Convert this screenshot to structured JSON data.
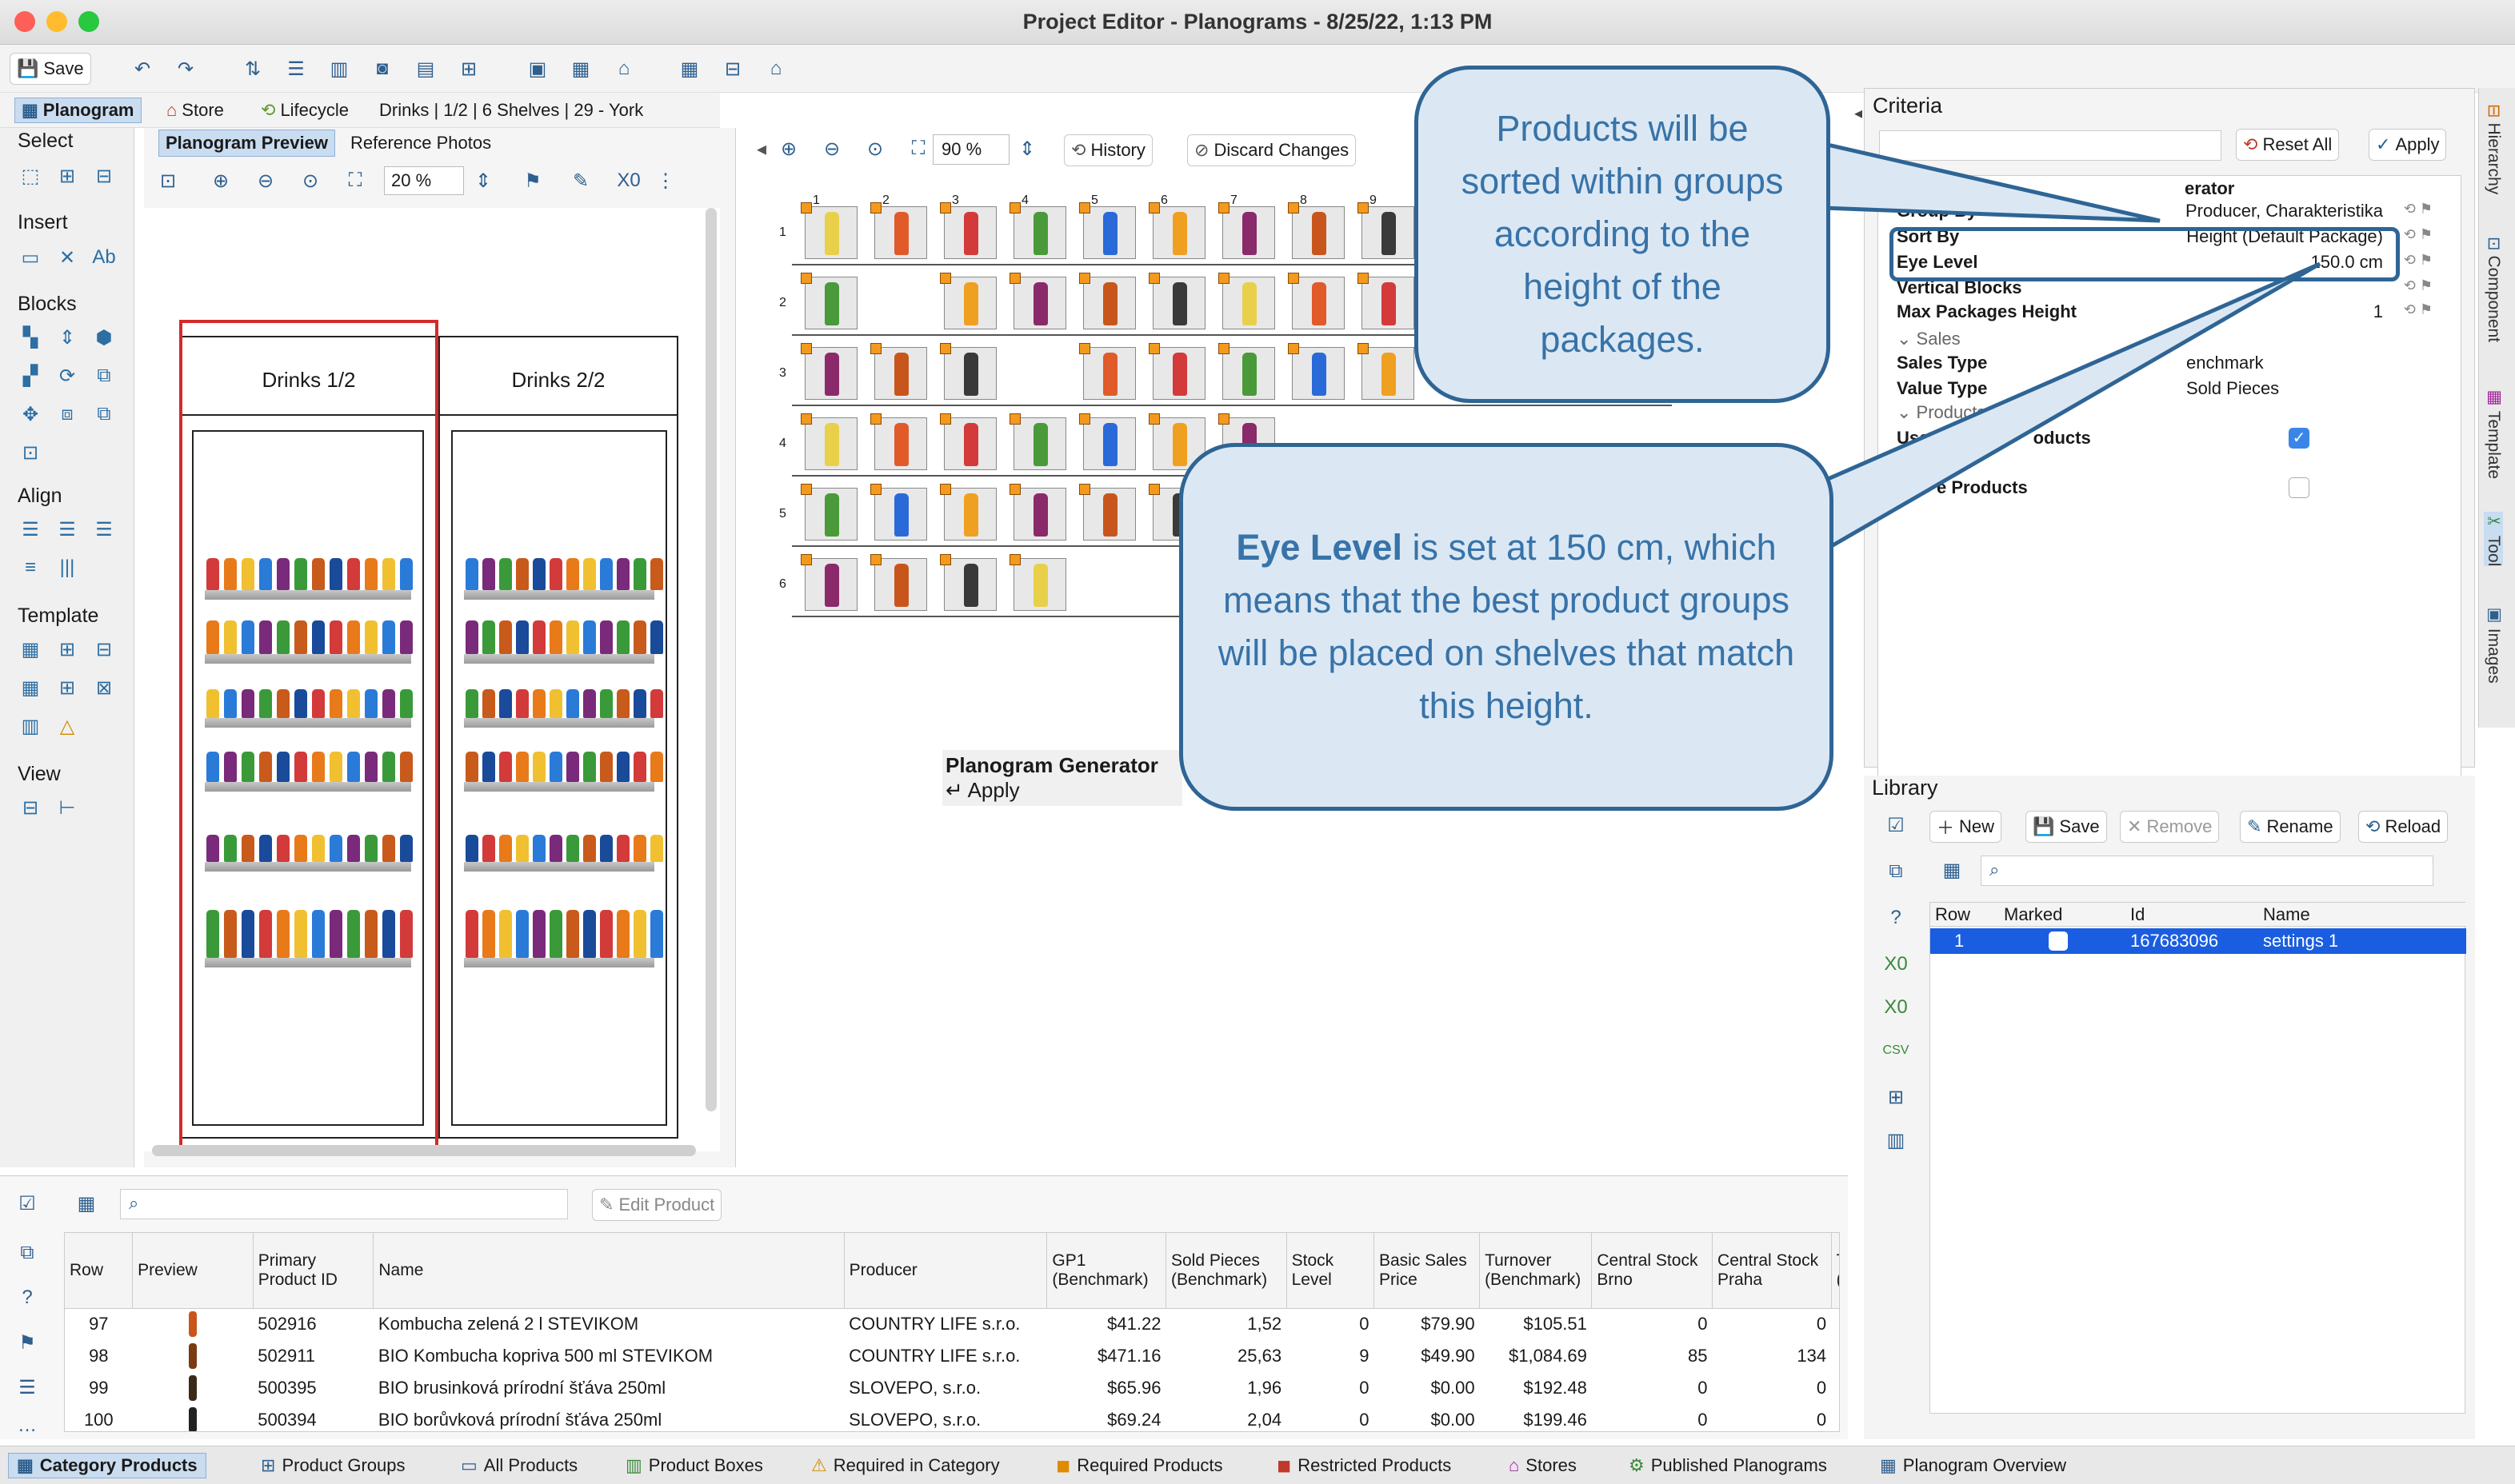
{
  "window": {
    "title": "Project Editor - Planograms - 8/25/22, 1:13 PM"
  },
  "toolbar": {
    "save_label": "Save"
  },
  "crumbs": {
    "planogram": "Planogram",
    "store": "Store",
    "lifecycle": "Lifecycle",
    "path": "Drinks | 1/2 | 6 Shelves | 29 - York"
  },
  "palette": {
    "select": "Select",
    "insert": "Insert",
    "blocks": "Blocks",
    "align": "Align",
    "template": "Template",
    "view": "View"
  },
  "preview": {
    "tab_preview": "Planogram Preview",
    "tab_photos": "Reference Photos",
    "zoom": "20 %",
    "cab1": "Drinks 1/2",
    "cab2": "Drinks 2/2"
  },
  "grid": {
    "zoom": "90 %",
    "history": "History",
    "discard": "Discard Changes",
    "cols": [
      "1",
      "2",
      "3",
      "4",
      "5",
      "6",
      "7",
      "8",
      "9"
    ],
    "rows": [
      "1",
      "2",
      "3",
      "4",
      "5",
      "6"
    ],
    "gen_title": "Planogram Generator",
    "gen_apply": "Apply"
  },
  "criteria": {
    "title": "Criteria",
    "reset": "Reset All",
    "apply": "Apply",
    "section_frag": "erator",
    "rows": [
      {
        "k": "Group By",
        "v": "Producer, Charakteristika"
      },
      {
        "k": "Sort By",
        "v": "Height (Default Package)"
      },
      {
        "k": "Eye Level",
        "v": "150.0 cm"
      },
      {
        "k": "Vertical Blocks",
        "v": ""
      },
      {
        "k": "Max Packages Height",
        "v": "1"
      }
    ],
    "sales": "Sales",
    "sales_type": "Sales Type",
    "sales_type_v": "enchmark",
    "value_type": "Value Type",
    "value_type_v": "Sold Pieces",
    "products": "Products",
    "use_cat": "Use Ca",
    "use_cat_tail": "oducts",
    "prod3": "e Products"
  },
  "library": {
    "title": "Library",
    "new": "New",
    "save": "Save",
    "remove": "Remove",
    "rename": "Rename",
    "reload": "Reload",
    "headers": [
      "Row",
      "Marked",
      "Id",
      "Name"
    ],
    "row": {
      "n": "1",
      "id": "167683096",
      "name": "settings 1"
    }
  },
  "right_tabs": [
    "Hierarchy",
    "Component",
    "Template",
    "Tool",
    "Images"
  ],
  "products": {
    "edit": "Edit Product",
    "headers": [
      "Row",
      "Preview",
      "Primary Product ID",
      "Name",
      "Producer",
      "GP1 (Benchmark)",
      "Sold Pieces (Benchmark)",
      "Stock Level",
      "Basic Sales Price",
      "Turnover (Benchmark)",
      "Central Stock Brno",
      "Central Stock Praha",
      "Tu (B"
    ],
    "rows": [
      [
        "97",
        "",
        "502916",
        "Kombucha zelená 2 l STEVIKOM",
        "COUNTRY LIFE s.r.o.",
        "$41.22",
        "1,52",
        "0",
        "$79.90",
        "$105.51",
        "0",
        "0"
      ],
      [
        "98",
        "",
        "502911",
        "BIO Kombucha kopriva 500 ml STEVIKOM",
        "COUNTRY LIFE s.r.o.",
        "$471.16",
        "25,63",
        "9",
        "$49.90",
        "$1,084.69",
        "85",
        "134"
      ],
      [
        "99",
        "",
        "500395",
        "BIO brusinková prírodní šťáva 250ml",
        "SLOVEPO, s.r.o.",
        "$65.96",
        "1,96",
        "0",
        "$0.00",
        "$192.48",
        "0",
        "0"
      ],
      [
        "100",
        "",
        "500394",
        "BIO borůvková prírodní šťáva 250ml",
        "SLOVEPO, s.r.o.",
        "$69.24",
        "2,04",
        "0",
        "$0.00",
        "$199.46",
        "0",
        "0"
      ]
    ]
  },
  "status_tabs": [
    "Category Products",
    "Product Groups",
    "All Products",
    "Product Boxes",
    "Required in Category",
    "Required Products",
    "Restricted Products",
    "Stores",
    "Published Planograms",
    "Planogram Overview"
  ],
  "callouts": {
    "sort": "Products will be sorted within groups according to the height of the packages.",
    "eye_bold": "Eye Level",
    "eye_rest": " is set at 150 cm, which means that the best product groups will be placed on shelves that match this height."
  }
}
